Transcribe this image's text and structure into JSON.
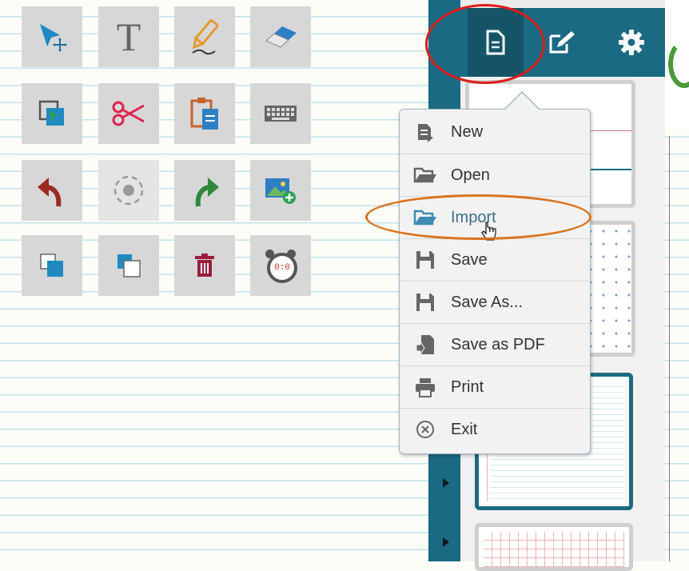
{
  "toolbar": {
    "tools": [
      {
        "name": "select",
        "icon": "select-arrow-icon"
      },
      {
        "name": "text",
        "icon": "text-icon",
        "glyph": "T"
      },
      {
        "name": "pen",
        "icon": "pencil-icon"
      },
      {
        "name": "eraser",
        "icon": "eraser-icon"
      },
      {
        "name": "screen-capture",
        "icon": "screen-capture-icon"
      },
      {
        "name": "cut",
        "icon": "scissors-icon"
      },
      {
        "name": "paste",
        "icon": "paste-icon"
      },
      {
        "name": "keyboard",
        "icon": "keyboard-icon"
      },
      {
        "name": "undo",
        "icon": "undo-icon"
      },
      {
        "name": "spotlight",
        "icon": "spotlight-icon",
        "disabled": true
      },
      {
        "name": "redo",
        "icon": "redo-icon"
      },
      {
        "name": "insert-image",
        "icon": "insert-image-icon"
      },
      {
        "name": "bring-to-front",
        "icon": "bring-to-front-icon"
      },
      {
        "name": "send-to-back",
        "icon": "send-to-back-icon"
      },
      {
        "name": "delete",
        "icon": "trash-icon"
      },
      {
        "name": "timer",
        "icon": "alarm-clock-icon",
        "glyph": "0:0"
      }
    ]
  },
  "header": {
    "tabs": [
      {
        "name": "file",
        "icon": "document-icon",
        "active": true
      },
      {
        "name": "edit",
        "icon": "edit-icon"
      },
      {
        "name": "settings",
        "icon": "gear-icon"
      }
    ]
  },
  "file_menu": {
    "items": [
      {
        "label": "New",
        "icon": "new-document-icon"
      },
      {
        "label": "Open",
        "icon": "folder-open-icon"
      },
      {
        "label": "Import",
        "icon": "folder-import-icon",
        "highlighted": true
      },
      {
        "label": "Save",
        "icon": "save-icon"
      },
      {
        "label": "Save As...",
        "icon": "save-as-icon"
      },
      {
        "label": "Save as PDF",
        "icon": "save-pdf-icon"
      },
      {
        "label": "Print",
        "icon": "printer-icon"
      },
      {
        "label": "Exit",
        "icon": "exit-icon"
      }
    ]
  },
  "colors": {
    "accent": "#1b6a83",
    "annotation_red": "#e01a1a",
    "annotation_orange": "#d8741f"
  }
}
